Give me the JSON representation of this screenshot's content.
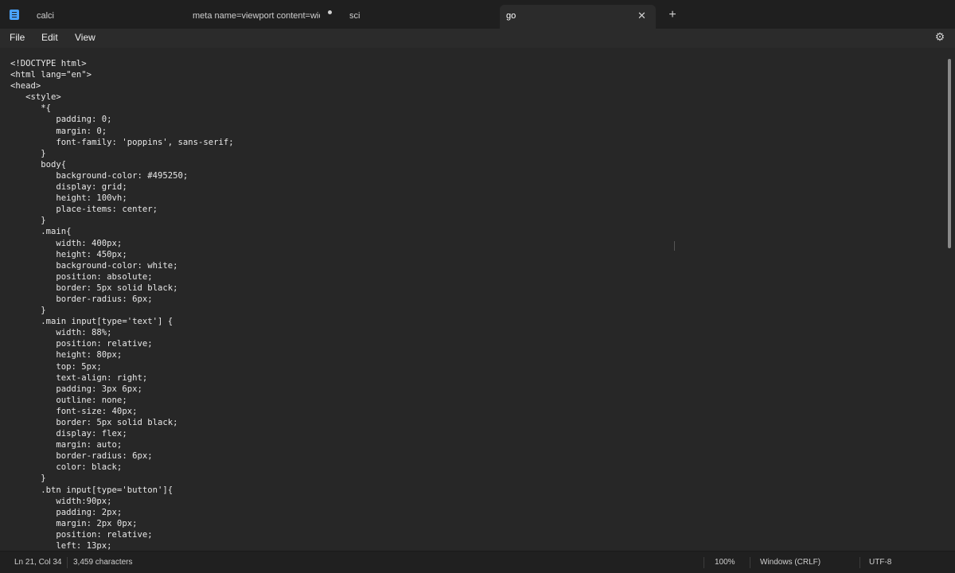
{
  "tabs": [
    {
      "label": "calci",
      "active": false,
      "unsaved": false
    },
    {
      "label": "meta name=viewport content=widt",
      "active": false,
      "unsaved": true
    },
    {
      "label": "sci",
      "active": false,
      "unsaved": false
    },
    {
      "label": "go",
      "active": true,
      "unsaved": false
    }
  ],
  "tab_close_glyph": "✕",
  "new_tab_glyph": "+",
  "menu": {
    "file": "File",
    "edit": "Edit",
    "view": "View"
  },
  "settings_icon": "gear-icon",
  "code_lines": [
    "<!DOCTYPE html>",
    "<html lang=\"en\">",
    "<head>",
    "   <style>",
    "      *{",
    "         padding: 0;",
    "         margin: 0;",
    "         font-family: 'poppins', sans-serif;",
    "      }",
    "      body{",
    "         background-color: #495250;",
    "         display: grid;",
    "         height: 100vh;",
    "         place-items: center;",
    "      }",
    "      .main{",
    "         width: 400px;",
    "         height: 450px;",
    "         background-color: white;",
    "         position: absolute;",
    "         border: 5px solid black;",
    "         border-radius: 6px;",
    "      }",
    "      .main input[type='text'] {",
    "         width: 88%;",
    "         position: relative;",
    "         height: 80px;",
    "         top: 5px;",
    "         text-align: right;",
    "         padding: 3px 6px;",
    "         outline: none;",
    "         font-size: 40px;",
    "         border: 5px solid black;",
    "         display: flex;",
    "         margin: auto;",
    "         border-radius: 6px;",
    "         color: black;",
    "      }",
    "      .btn input[type='button']{",
    "         width:90px;",
    "         padding: 2px;",
    "         margin: 2px 0px;",
    "         position: relative;",
    "         left: 13px;"
  ],
  "status": {
    "position": "Ln 21, Col 34",
    "characters": "3,459 characters",
    "zoom": "100%",
    "line_ending": "Windows (CRLF)",
    "encoding": "UTF-8"
  }
}
